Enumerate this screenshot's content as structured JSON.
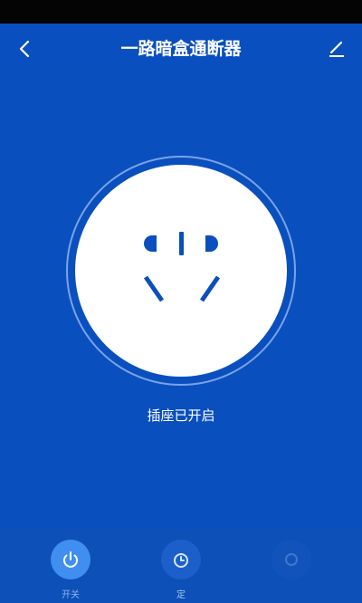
{
  "header": {
    "title": "一路暗盒通断器",
    "back_icon": "chevron-left-icon",
    "edit_icon": "pencil-edit-icon"
  },
  "main": {
    "socket_icon": "power-socket-icon",
    "status": "插座已开启"
  },
  "bottom_bar": {
    "tabs": [
      {
        "label": "开关",
        "icon": "power-icon"
      },
      {
        "label": "定",
        "icon": "timer-icon"
      },
      {
        "label": "",
        "icon": "more-icon"
      }
    ]
  },
  "colors": {
    "background": "#0b4fbe",
    "status_bar": "#040404",
    "socket_face": "#ffffff",
    "socket_symbol": "#0b4fbe",
    "active_tab": "#3f8ef0",
    "tab_label": "#8fb4ee"
  }
}
